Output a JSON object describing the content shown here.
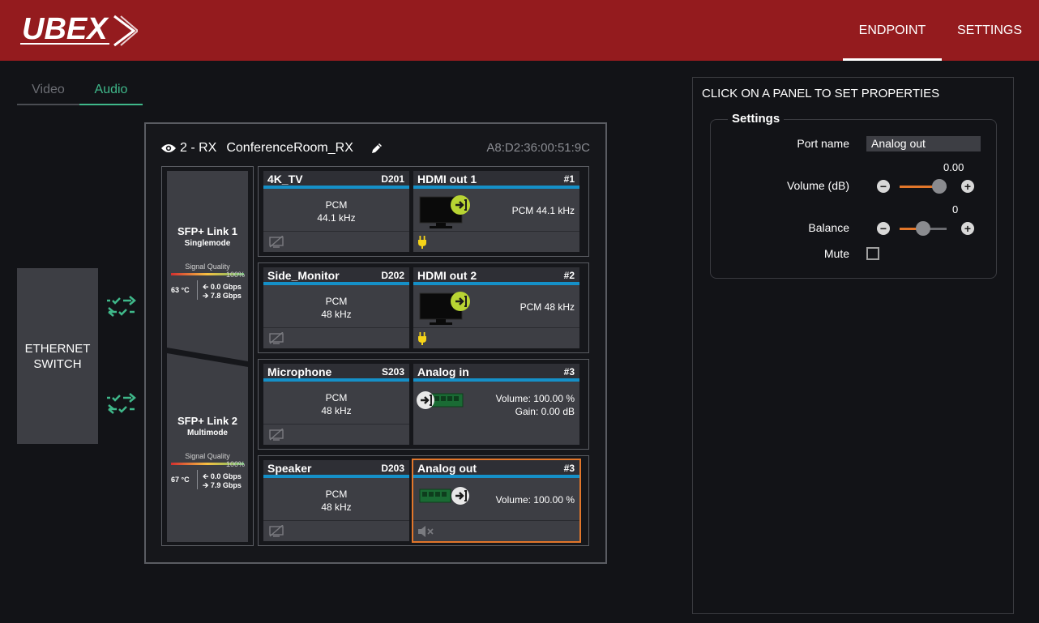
{
  "header": {
    "logo_text": "UBEX",
    "nav": {
      "endpoint": "ENDPOINT",
      "settings": "SETTINGS"
    },
    "brand_color": "#941b1e"
  },
  "subtabs": {
    "video": "Video",
    "audio": "Audio"
  },
  "ethernet_switch": {
    "label_line1": "ETHERNET",
    "label_line2": "SWITCH"
  },
  "device": {
    "id": "2 - RX",
    "name": "ConferenceRoom_RX",
    "mac": "A8:D2:36:00:51:9C"
  },
  "sfp": [
    {
      "title": "SFP+ Link 1",
      "mode": "Singlemode",
      "signal_label": "Signal Quality",
      "signal_pct": "100%",
      "temp": "63 °C",
      "rx": "0.0 Gbps",
      "tx": "7.8 Gbps"
    },
    {
      "title": "SFP+ Link 2",
      "mode": "Multimode",
      "signal_label": "Signal Quality",
      "signal_pct": "100%",
      "temp": "67 °C",
      "rx": "0.0 Gbps",
      "tx": "7.9 Gbps"
    }
  ],
  "rows": [
    {
      "left": {
        "name": "4K_TV",
        "code": "D201",
        "line1": "PCM",
        "line2": "44.1 kHz"
      },
      "right": {
        "name": "HDMI out 1",
        "code": "#1",
        "info1": "PCM 44.1 kHz",
        "info2": ""
      }
    },
    {
      "left": {
        "name": "Side_Monitor",
        "code": "D202",
        "line1": "PCM",
        "line2": "48 kHz"
      },
      "right": {
        "name": "HDMI out 2",
        "code": "#2",
        "info1": "PCM 48 kHz",
        "info2": ""
      }
    },
    {
      "left": {
        "name": "Microphone",
        "code": "S203",
        "line1": "PCM",
        "line2": "48 kHz"
      },
      "right": {
        "name": "Analog in",
        "code": "#3",
        "info1": "Volume: 100.00 %",
        "info2": "Gain: 0.00 dB"
      }
    },
    {
      "left": {
        "name": "Speaker",
        "code": "D203",
        "line1": "PCM",
        "line2": "48 kHz"
      },
      "right": {
        "name": "Analog out",
        "code": "#3",
        "info1": "Volume: 100.00 %",
        "info2": ""
      }
    }
  ],
  "properties": {
    "title": "CLICK ON A PANEL TO SET PROPERTIES",
    "settings_legend": "Settings",
    "port_name_label": "Port name",
    "port_name_value": "Analog out",
    "volume_label": "Volume (dB)",
    "volume_value": "0.00",
    "volume_level": 0.85,
    "balance_label": "Balance",
    "balance_value": "0",
    "balance_level": 0.5,
    "mute_label": "Mute",
    "mute_checked": false,
    "accent_color": "#e2762a"
  },
  "colors": {
    "panel_blue": "#1590c8",
    "link_green": "#3fb88a",
    "selected_outline": "#e2762a"
  }
}
